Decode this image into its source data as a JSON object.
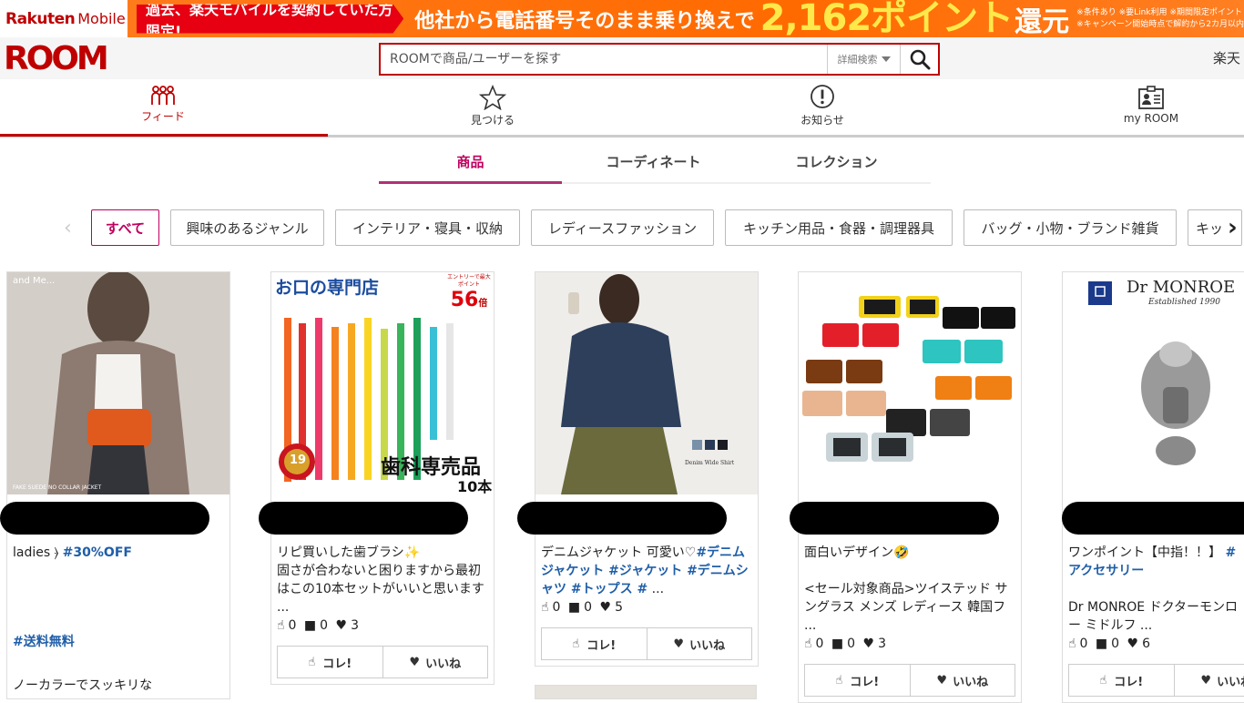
{
  "banner": {
    "brand_rakuten": "Rakuten",
    "brand_mobile": "Mobile",
    "tag": "過去、楽天モバイルを契約していた方限定!",
    "headline": "他社から電話番号そのまま乗り換えで",
    "points": "2,162ポイント",
    "points_suffix": "還元",
    "note1": "※条件あり ※要Link利用 ※期間限定ポイント",
    "note2": "※キャンペーン開始時点で解約から2カ月以内"
  },
  "header": {
    "logo": "ROOM",
    "search_placeholder": "ROOMで商品/ユーザーを探す",
    "detail_search": "詳細検索",
    "rakuten_link": "楽天"
  },
  "nav": {
    "items": [
      {
        "label": "フィード",
        "icon": "people-icon"
      },
      {
        "label": "見つける",
        "icon": "star-icon"
      },
      {
        "label": "お知らせ",
        "icon": "exclamation-icon"
      },
      {
        "label": "my ROOM",
        "icon": "profile-card-icon"
      }
    ]
  },
  "subtabs": [
    "商品",
    "コーディネート",
    "コレクション"
  ],
  "chips": [
    "すべて",
    "興味のあるジャンル",
    "インテリア・寝具・収納",
    "レディースファッション",
    "キッチン用品・食器・調理器具",
    "バッグ・小物・ブランド雑貨",
    "キッ"
  ],
  "colors": {
    "brand_red": "#bf0000",
    "accent_magenta": "#bf005f",
    "tag_blue": "#1f5ea8"
  },
  "cards": [
    {
      "img_caption": "and Me...",
      "img_bottom_caption": "FAKE SUEDE NO COLLAR JACKET",
      "desc_line1": "ladies ⦒ ",
      "desc_tag1": "#30%OFF",
      "desc_tag2": "#送料無料",
      "desc_tail": "ノーカラーでスッキリな"
    },
    {
      "img_title": "お口の専門店",
      "img_badge": "エントリーで最大 ポイント",
      "img_badge_num": "56",
      "img_badge_unit": "倍",
      "img_seal": "19",
      "img_label1": "歯科専売品",
      "img_label2": "10本",
      "desc": "リピ買いした歯ブラシ✨\n固さが合わないと困りますから最初はこの10本セットがいいと思います ...",
      "stats": {
        "cole": "0",
        "comments": "0",
        "likes": "3"
      },
      "btn_cole": "コレ!",
      "btn_like": "いいね"
    },
    {
      "img_caption": "Denim Wide Shirt",
      "desc_plain": "デニムジャケット 可愛い♡",
      "desc_tags": "#デニムジャケット #ジャケット #デニムシャツ #トップス #",
      "desc_ellipsis": " ...",
      "stats": {
        "cole": "0",
        "comments": "0",
        "likes": "5"
      },
      "btn_cole": "コレ!",
      "btn_like": "いいね"
    },
    {
      "desc": "面白いデザイン🤣\n\n<セール対象商品>ツイステッド サングラス メンズ レディース 韓国フ ...",
      "stats": {
        "cole": "0",
        "comments": "0",
        "likes": "3"
      },
      "btn_cole": "コレ!",
      "btn_like": "いいね"
    },
    {
      "img_brand": "Dr MONROE",
      "img_est": "Established 1990",
      "desc_plain": "ワンポイント【中指！！】 ",
      "desc_tags": "#アクセサリー",
      "desc_body": "Dr MONROE ドクターモンロー ミドルフ ...",
      "stats": {
        "cole": "0",
        "comments": "0",
        "likes": "6"
      },
      "btn_cole": "コレ!",
      "btn_like": "いいね"
    }
  ]
}
